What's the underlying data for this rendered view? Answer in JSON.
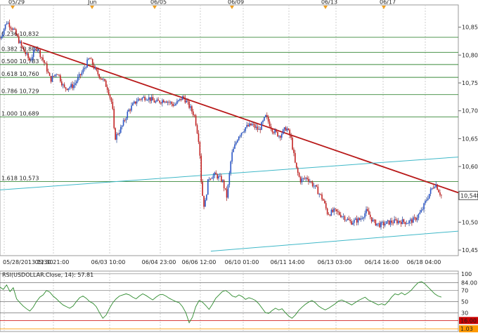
{
  "chart_data": [
    {
      "type": "candlestick",
      "title": "",
      "top_date_markers": [
        "05/29",
        "Jun",
        "06/05",
        "06/09",
        "06/13",
        "06/17"
      ],
      "x_ticks": [
        "05/28/2013 11:30",
        "05/30 21:00",
        "06/03 10:00",
        "06/04 23:00",
        "06/06 12:00",
        "06/10 01:00",
        "06/11 14:00",
        "06/13 03:00",
        "06/14 16:00",
        "06/18 04:00"
      ],
      "y_ticks": [
        "10,850",
        "10,800",
        "10,750",
        "10,700",
        "10,650",
        "10,600",
        "10,550",
        "10,500",
        "10,450"
      ],
      "ylim": [
        10440,
        10890
      ],
      "last_price": "10,548",
      "fib_levels": [
        {
          "label": "0.236 10,832",
          "value": 10832
        },
        {
          "label": "0.382 10,805",
          "value": 10805
        },
        {
          "label": "0.500 10,783",
          "value": 10783
        },
        {
          "label": "0.618 10,760",
          "value": 10760
        },
        {
          "label": "0.786 10,729",
          "value": 10729
        },
        {
          "label": "1.000 10,689",
          "value": 10689
        },
        {
          "label": "1.618 10,573",
          "value": 10573
        }
      ],
      "close_path": [
        [
          0,
          10830
        ],
        [
          1.5,
          10860
        ],
        [
          3,
          10845
        ],
        [
          5,
          10810
        ],
        [
          6.5,
          10790
        ],
        [
          8,
          10815
        ],
        [
          10,
          10780
        ],
        [
          11,
          10755
        ],
        [
          12.5,
          10770
        ],
        [
          14,
          10740
        ],
        [
          16,
          10745
        ],
        [
          18,
          10770
        ],
        [
          19.5,
          10795
        ],
        [
          21,
          10770
        ],
        [
          22.5,
          10755
        ],
        [
          23.5,
          10740
        ],
        [
          24.5,
          10710
        ],
        [
          25,
          10650
        ],
        [
          26.5,
          10670
        ],
        [
          28,
          10700
        ],
        [
          30,
          10720
        ],
        [
          32,
          10725
        ],
        [
          34,
          10715
        ],
        [
          36,
          10720
        ],
        [
          38,
          10710
        ],
        [
          40,
          10725
        ],
        [
          41.5,
          10705
        ],
        [
          42.5,
          10690
        ],
        [
          43.5,
          10640
        ],
        [
          44,
          10560
        ],
        [
          44.6,
          10525
        ],
        [
          45.5,
          10580
        ],
        [
          47,
          10585
        ],
        [
          48.5,
          10575
        ],
        [
          49.5,
          10545
        ],
        [
          50.5,
          10620
        ],
        [
          52,
          10655
        ],
        [
          53.5,
          10670
        ],
        [
          55,
          10675
        ],
        [
          56.5,
          10665
        ],
        [
          58,
          10690
        ],
        [
          59.5,
          10665
        ],
        [
          61,
          10655
        ],
        [
          62.5,
          10670
        ],
        [
          63.5,
          10650
        ],
        [
          64.5,
          10600
        ],
        [
          65.5,
          10575
        ],
        [
          67,
          10580
        ],
        [
          68,
          10570
        ],
        [
          69,
          10560
        ],
        [
          70.5,
          10540
        ],
        [
          71.5,
          10515
        ],
        [
          73,
          10520
        ],
        [
          75,
          10510
        ],
        [
          76.5,
          10500
        ],
        [
          78.5,
          10505
        ],
        [
          80,
          10520
        ],
        [
          81.5,
          10500
        ],
        [
          83,
          10495
        ],
        [
          85,
          10500
        ],
        [
          87,
          10502
        ],
        [
          89,
          10500
        ],
        [
          90.5,
          10505
        ],
        [
          92,
          10520
        ],
        [
          93,
          10540
        ],
        [
          94.2,
          10560
        ],
        [
          95,
          10570
        ],
        [
          95.8,
          10555
        ],
        [
          96.3,
          10548
        ]
      ],
      "trendlines": [
        {
          "name": "resistance",
          "from": [
            5,
            10822
          ],
          "to": [
            100,
            10553
          ]
        },
        {
          "name": "upper-channel",
          "from": [
            0,
            10558
          ],
          "to": [
            100,
            10617
          ]
        },
        {
          "name": "lower-channel",
          "from": [
            46,
            10448
          ],
          "to": [
            100,
            10484
          ]
        }
      ]
    },
    {
      "type": "line",
      "legend_label": "RSI(USDOLLAR.Close, 14): 57.81",
      "y_ticks": [
        "100",
        "84.00",
        "70",
        "50",
        "30"
      ],
      "level_badges": [
        {
          "label": "16.00",
          "color": "#cc0000"
        },
        {
          "label": "1.03",
          "color": "#ff9900"
        }
      ],
      "ylim": [
        0,
        100
      ],
      "values": [
        76,
        72,
        80,
        68,
        75,
        55,
        48,
        42,
        37,
        33,
        40,
        50,
        58,
        62,
        70,
        67,
        60,
        55,
        49,
        44,
        41,
        38,
        42,
        50,
        57,
        60,
        56,
        50,
        47,
        41,
        30,
        20,
        26,
        38,
        48,
        55,
        60,
        62,
        64,
        62,
        58,
        55,
        60,
        64,
        61,
        57,
        53,
        58,
        62,
        63,
        60,
        56,
        53,
        50,
        48,
        41,
        30,
        12,
        22,
        41,
        52,
        49,
        43,
        36,
        45,
        56,
        62,
        68,
        70,
        66,
        60,
        58,
        62,
        59,
        54,
        57,
        55,
        52,
        46,
        38,
        30,
        29,
        34,
        38,
        35,
        37,
        30,
        24,
        20,
        26,
        34,
        40,
        45,
        49,
        52,
        48,
        42,
        38,
        35,
        38,
        42,
        46,
        51,
        53,
        50,
        47,
        44,
        48,
        52,
        55,
        58,
        53,
        50,
        47,
        44,
        46,
        44,
        50,
        58,
        64,
        62,
        66,
        62,
        66,
        71,
        78,
        84,
        86,
        82,
        76,
        70,
        64,
        60,
        58
      ]
    }
  ]
}
